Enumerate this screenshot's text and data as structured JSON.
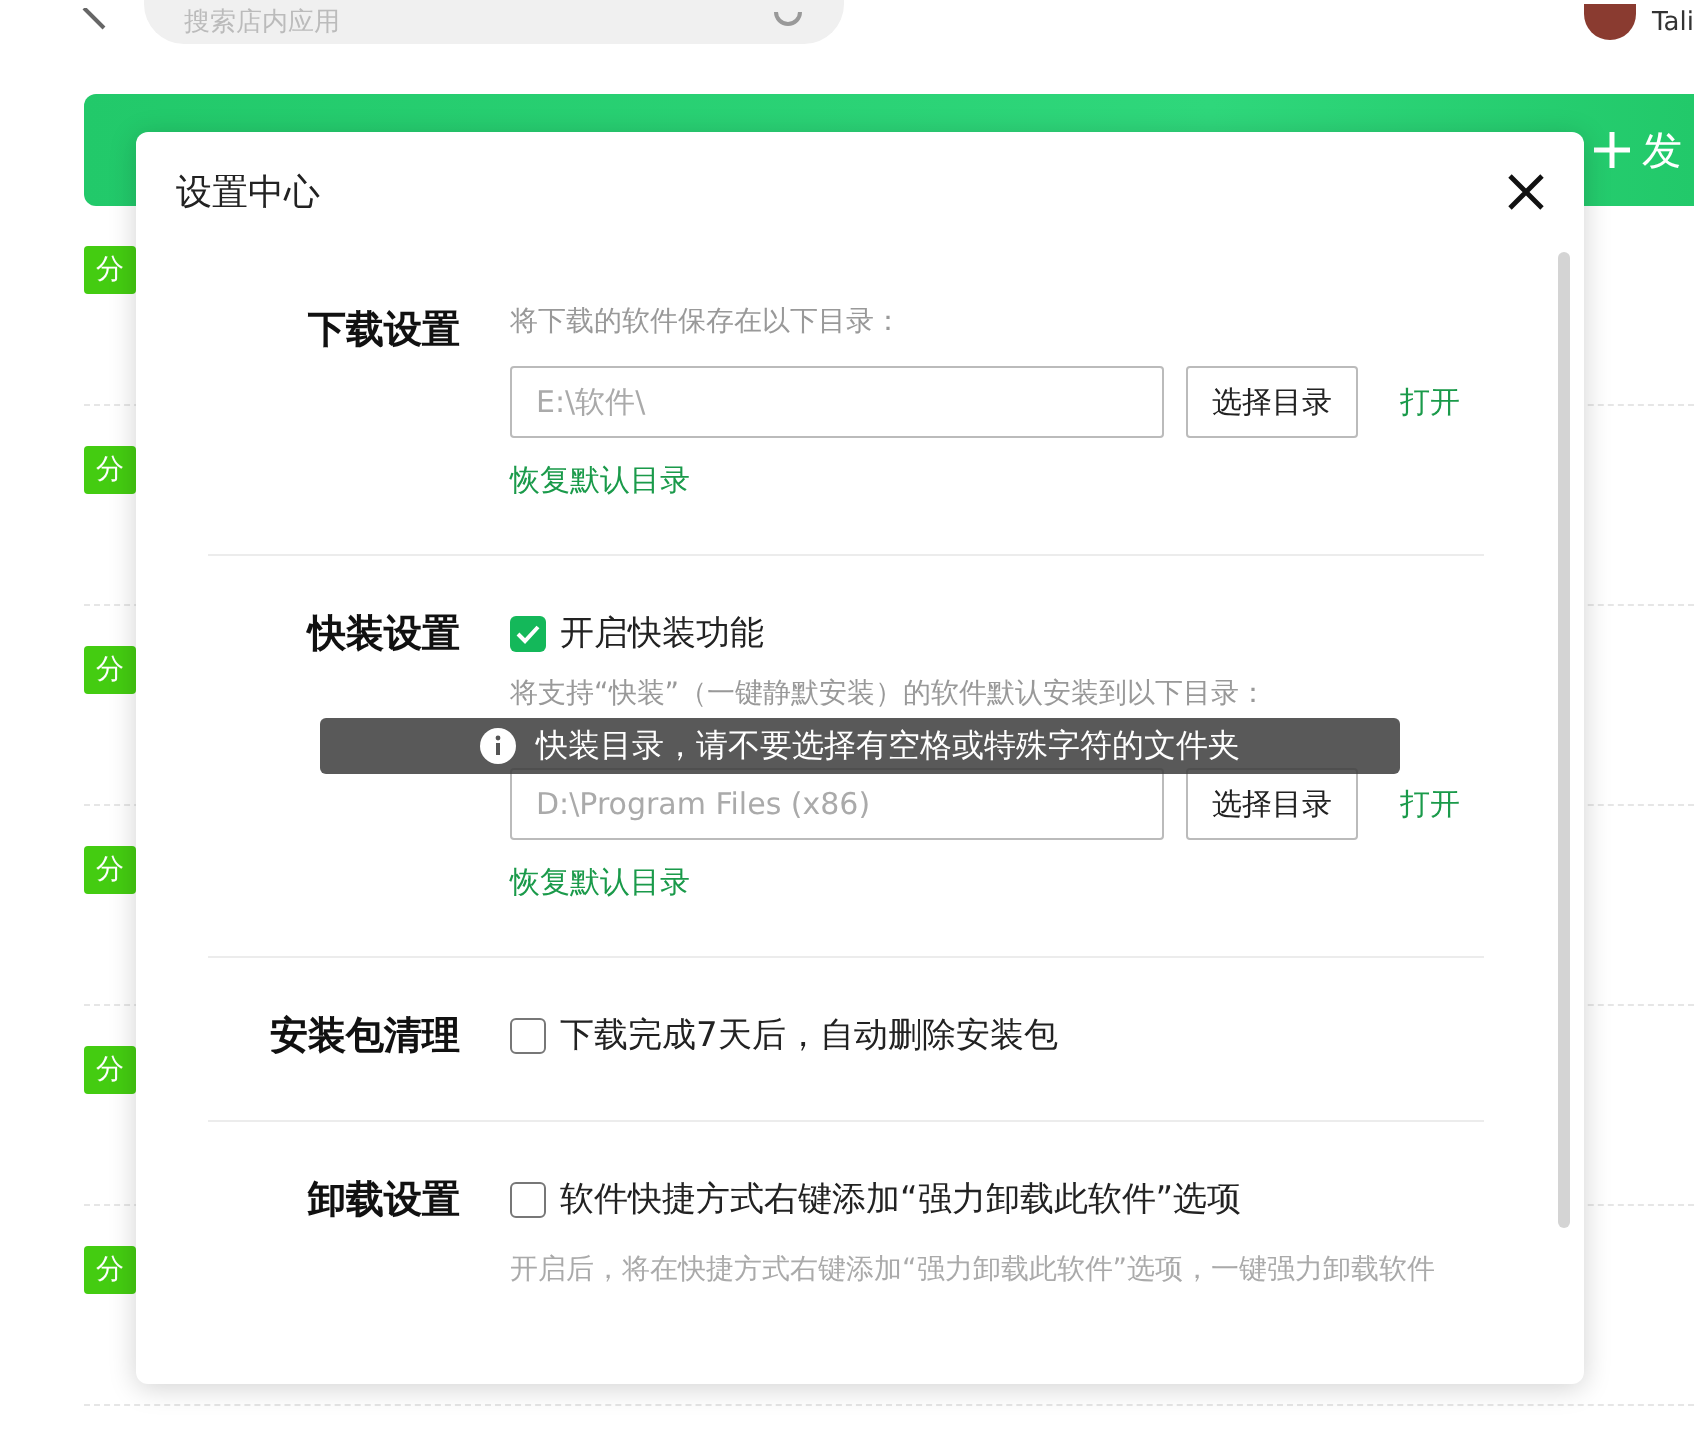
{
  "topbar": {
    "search": {
      "placeholder": "搜索店内应用"
    },
    "user_name": "Tali"
  },
  "banner": {
    "action_label": "发"
  },
  "list_tags": [
    "分",
    "分",
    "分",
    "分",
    "分",
    "分"
  ],
  "dialog": {
    "title": "设置中心",
    "sections": [
      {
        "label": "下载设置",
        "hint": "将下载的软件保存在以下目录：",
        "path": "E:\\软件\\",
        "choose_button": "选择目录",
        "open_link": "打开",
        "restore_link": "恢复默认目录"
      },
      {
        "label": "快装设置",
        "checkbox": {
          "label": "开启快装功能",
          "checked": true
        },
        "hint": "将支持“快装”（一键静默安装）的软件默认安装到以下目录：",
        "path": "D:\\Program Files (x86)",
        "choose_button": "选择目录",
        "open_link": "打开",
        "restore_link": "恢复默认目录"
      },
      {
        "label": "安装包清理",
        "checkbox": {
          "label": "下载完成7天后，自动删除安装包",
          "checked": false
        }
      },
      {
        "label": "卸载设置",
        "checkbox": {
          "label": "软件快捷方式右键添加“强力卸载此软件”选项",
          "checked": false
        },
        "note": "开启后，将在快捷方式右键添加“强力卸载此软件”选项，一键强力卸载软件"
      }
    ]
  },
  "toast": {
    "message": "快装目录，请不要选择有空格或特殊字符的文件夹"
  }
}
